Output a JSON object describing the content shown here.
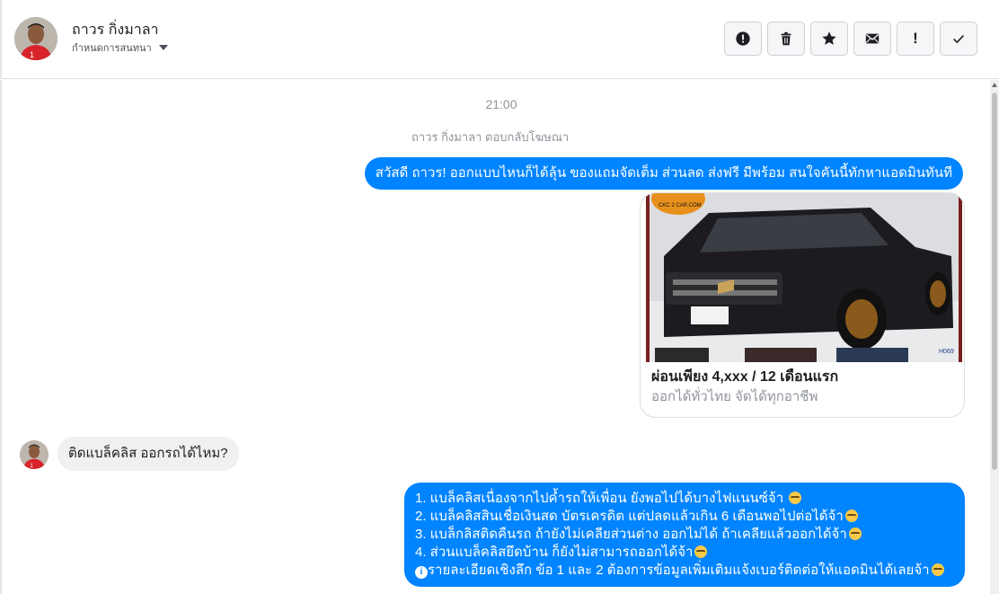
{
  "header": {
    "contact_name": "ถาวร กิ่งมาลา",
    "assign_label": "กำหนดการสนทนา"
  },
  "toolbar": {
    "buttons": [
      {
        "icon": "alert-circle-icon"
      },
      {
        "icon": "trash-icon"
      },
      {
        "icon": "star-icon"
      },
      {
        "icon": "envelope-icon"
      },
      {
        "icon": "exclamation-icon",
        "label": "!"
      },
      {
        "icon": "checkmark-icon"
      }
    ]
  },
  "chat": {
    "timestamp": "21:00",
    "reply_note": "ถาวร กิ่งมาลา ตอบกลับโฆษณา",
    "messages": {
      "greeting": "สวัสดี ถาวร! ออกแบบไหนก็ได้ลุ้น ของแถมจัดเต็ม ส่วนลด ส่งฟรี มีพร้อม สนใจคันนี้ทักหาแอดมินทันที",
      "card_title": "ผ่อนเพียง 4,xxx / 12 เดือนแรก",
      "card_subtitle": "ออกได้ทั่วไทย จัดได้ทุกอาชีพ",
      "card_logo_text": "CKC 2 CAR.COM",
      "card_code": "H069",
      "incoming": "ติดแบล็คลิส ออกรถได้ไหม?",
      "reply_lines": [
        "1. แบล็คลิสเนื่องจากไปค้ำรถให้เพื่อน ยังพอไปได้บางไฟแนนซ์จ้า ",
        "2. แบล็คลิสสินเชื่อเงินสด บัตรเครดิต แต่ปลดแล้วเกิน 6 เดือนพอไปต่อได้จ้า",
        "3. แบล็กลิสติดคืนรถ ถ้ายังไม่เคลียส่วนต่าง ออกไม่ได้ ถ้าเคลียแล้วออกได้จ้า",
        "4. ส่วนแบล็คลิสยึดบ้าน ก็ยังไม่สามารถออกได้จ้า",
        "รายละเอียดเชิงลึก ข้อ 1 และ 2 ต้องการข้อมูลเพิ่มเติมแจ้งเบอร์ติดต่อให้แอดมินได้เลยจ้า"
      ],
      "info_glyph": "i"
    }
  },
  "colors": {
    "outgoing_bubble": "#0084ff",
    "incoming_bubble": "#f1f0f0",
    "meta_text": "#90949c"
  }
}
